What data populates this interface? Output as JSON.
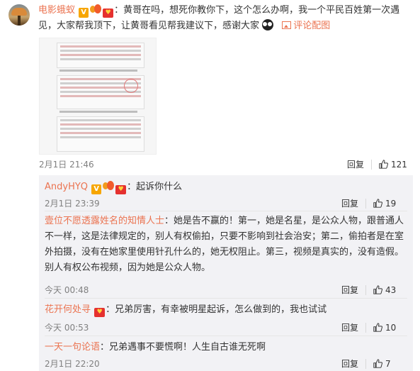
{
  "post": {
    "username": "电影蛾蚁",
    "text": "：黄哥在吗，想死你教你下，这个怎么办啊，我一个平民百姓第一次遇见，大家帮我顶下，让黄哥看见帮我建议下，感谢大家",
    "view_image_link": "评论配图",
    "timestamp": "2月1日 21:46",
    "reply_label": "回复",
    "like_count": "121"
  },
  "replies": [
    {
      "username": "AndyHYQ",
      "text": "：起诉你什么",
      "timestamp": "2月1日 23:39",
      "reply_label": "回复",
      "like_count": "19",
      "badges": [
        "v",
        "vip",
        "heart"
      ]
    },
    {
      "username": "壹位不愿透露姓名的知情人士",
      "text": "：她是告不赢的！第一，她是名星，是公众人物，跟普通人不一样，这是法律规定的，别人有权偷拍，只要不影响到社会治安；第二，偷拍者是在室外拍摄，没有在她家里使用针孔什么的，她无权阻止。第三，视频是真实的，没有造假。别人有权公布视频，因为她是公众人物。",
      "timestamp": "今天 00:48",
      "reply_label": "回复",
      "like_count": "43",
      "badges": []
    },
    {
      "username": "花开何处寻",
      "text": "：兄弟厉害，有幸被明星起诉，怎么做到的，我也试试",
      "timestamp": "今天 00:53",
      "reply_label": "回复",
      "like_count": "10",
      "badges": [
        "heart"
      ]
    },
    {
      "username": "一天一句论语",
      "text": "：兄弟遇事不要慌啊！人生自古谁无死啊",
      "timestamp": "2月1日 22:20",
      "reply_label": "回复",
      "like_count": "7",
      "badges": []
    }
  ],
  "colors": {
    "username": "#eb7350",
    "text": "#333333",
    "meta": "#808080",
    "reply_bg": "#f2f2f5"
  },
  "icons": {
    "like": "thumbs-up-icon",
    "image": "picture-icon",
    "verified": "verified-v-icon",
    "vip": "vip-icon",
    "fan": "fan-heart-icon"
  }
}
